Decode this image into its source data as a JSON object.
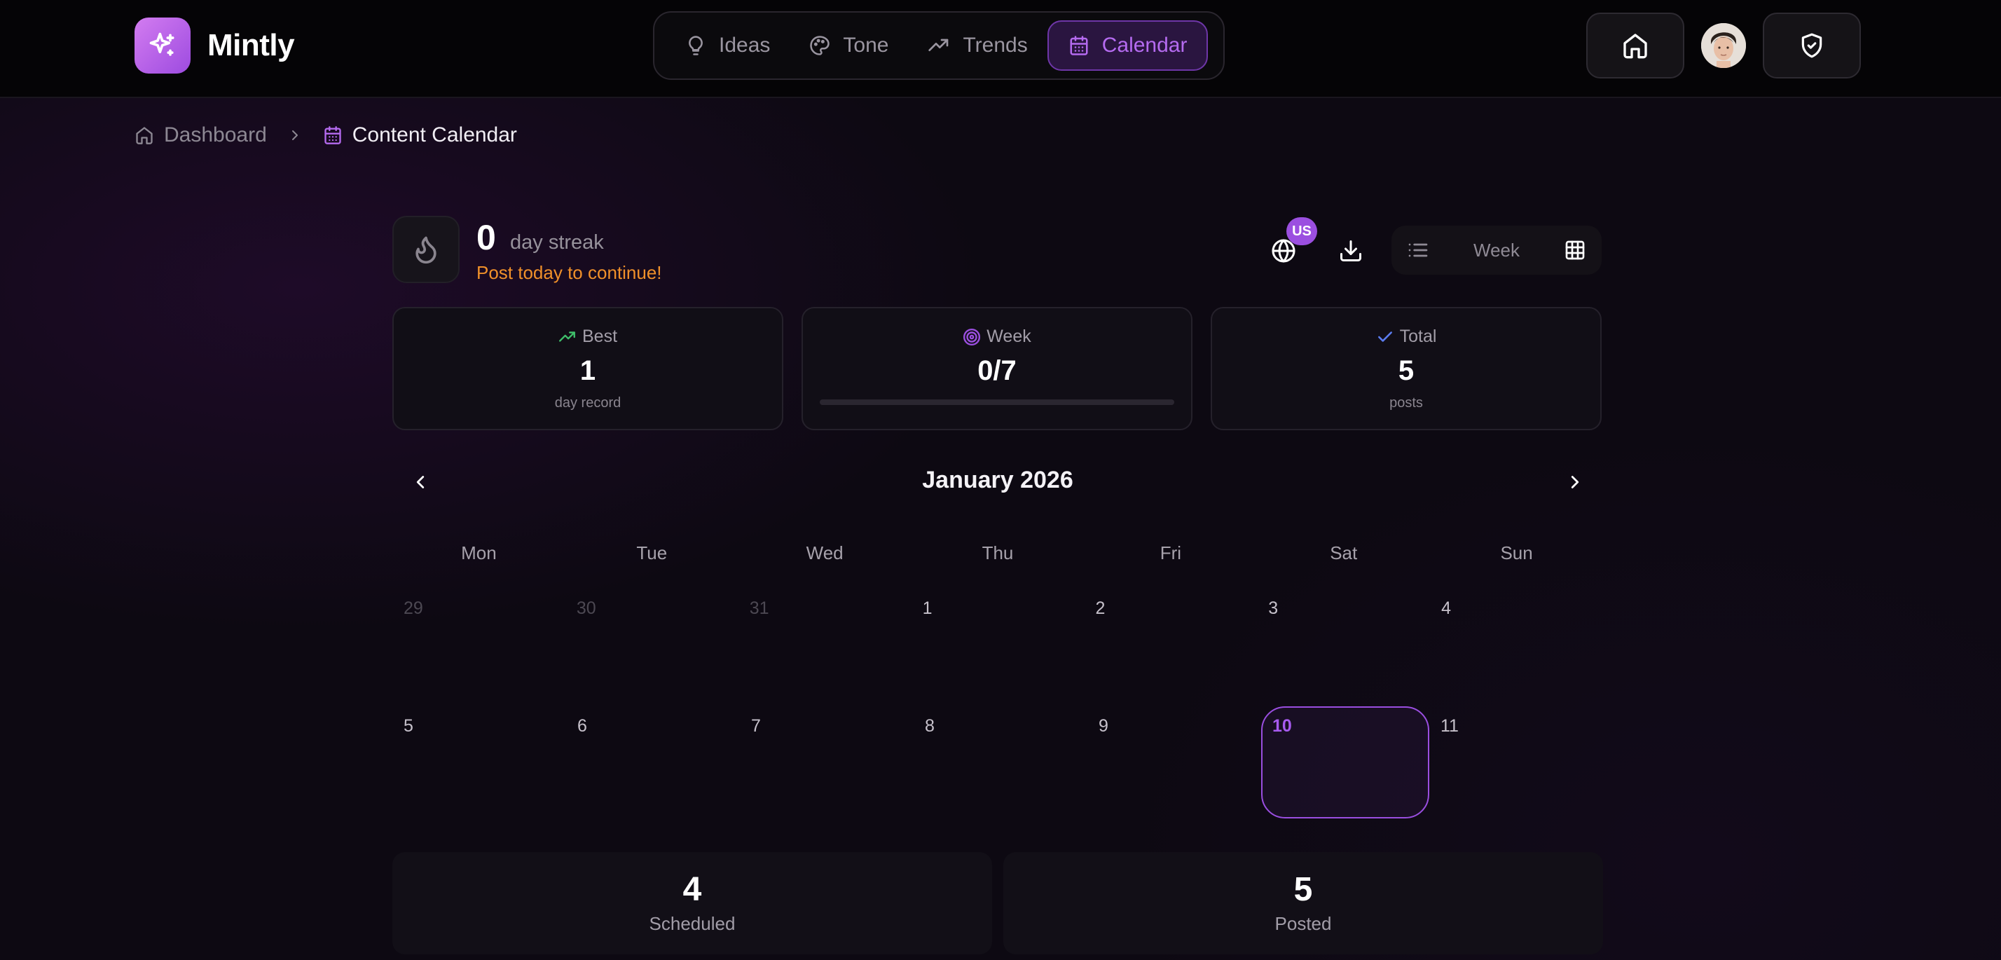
{
  "app": {
    "name": "Mintly"
  },
  "nav": {
    "items": [
      {
        "label": "Ideas",
        "icon": "lightbulb-icon",
        "active": false
      },
      {
        "label": "Tone",
        "icon": "palette-icon",
        "active": false
      },
      {
        "label": "Trends",
        "icon": "trending-up-icon",
        "active": false
      },
      {
        "label": "Calendar",
        "icon": "calendar-icon",
        "active": true
      }
    ]
  },
  "header_actions": {
    "home": "home-icon",
    "avatar": "avatar",
    "security": "shield-check-icon"
  },
  "breadcrumb": {
    "home": "Dashboard",
    "current": "Content Calendar"
  },
  "streak": {
    "count": "0",
    "label": "day streak",
    "hint": "Post today to continue!"
  },
  "toolbar": {
    "region_badge": "US",
    "view_week": "Week"
  },
  "stats": {
    "best": {
      "label": "Best",
      "value": "1",
      "sub": "day record"
    },
    "week": {
      "label": "Week",
      "value": "0/7",
      "progress": 0
    },
    "total": {
      "label": "Total",
      "value": "5",
      "sub": "posts"
    }
  },
  "calendar": {
    "month": "January 2026",
    "weekdays": [
      "Mon",
      "Tue",
      "Wed",
      "Thu",
      "Fri",
      "Sat",
      "Sun"
    ],
    "weeks": [
      [
        "29",
        "30",
        "31",
        "1",
        "2",
        "3",
        "4"
      ],
      [
        "5",
        "6",
        "7",
        "8",
        "9",
        "10",
        "11"
      ]
    ],
    "today": "10"
  },
  "summary": {
    "scheduled": {
      "value": "4",
      "label": "Scheduled"
    },
    "posted": {
      "value": "5",
      "label": "Posted"
    }
  },
  "colors": {
    "accent": "#9b4fe0",
    "streak_hint": "#f0902a",
    "best_icon": "#3fbf6a",
    "total_icon": "#5b7cf0"
  }
}
